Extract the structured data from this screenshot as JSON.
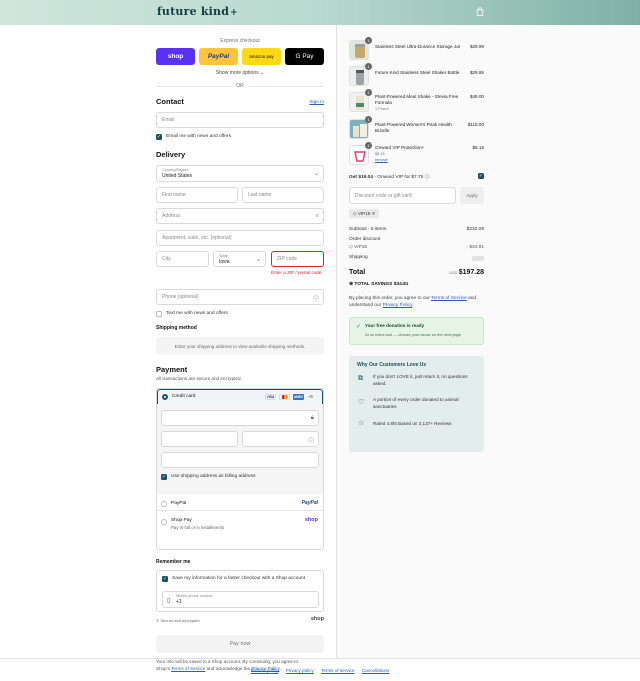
{
  "header": {
    "brand": "future kind",
    "brand_plus": "+"
  },
  "express": {
    "label": "Express checkout",
    "shop": "shop",
    "paypal": "PayPal",
    "amazon": "amazon pay",
    "gpay": "G Pay",
    "show_more": "Show more options",
    "or": "OR"
  },
  "contact": {
    "title": "Contact",
    "sign_in": "Sign in",
    "email_placeholder": "Email",
    "news_label": "Email me with news and offers"
  },
  "delivery": {
    "title": "Delivery",
    "country_label": "Country/Region",
    "country_value": "United States",
    "first_name": "First name",
    "last_name": "Last name",
    "address": "Address",
    "apartment": "Apartment, suite, etc. (optional)",
    "city": "City",
    "state_label": "State",
    "state_value": "Iowa",
    "zip": "ZIP code",
    "zip_error": "Enter a ZIP / postal code",
    "phone": "Phone (optional)",
    "text_news": "Text me with news and offers"
  },
  "shipping": {
    "title": "Shipping method",
    "info": "Enter your shipping address to view available shipping methods."
  },
  "payment": {
    "title": "Payment",
    "subtitle": "All transactions are secure and encrypted.",
    "credit_card": "Credit card",
    "card_logos": [
      "VISA",
      "MC",
      "AMEX"
    ],
    "more_cards": "+5",
    "billing_same": "Use shipping address as billing address",
    "paypal": "PayPal",
    "paypal_logo": "PayPal",
    "shop_pay": "Shop Pay",
    "shop_pay_sub": "Pay in full or in installments",
    "shop_pay_logo": "shop"
  },
  "remember": {
    "title": "Remember me",
    "save_label": "Save my information for a faster checkout with a Shop account",
    "mobile_label": "Mobile phone number",
    "mobile_value": "+1",
    "secure": "Secure and encrypted",
    "shop_logo": "shop"
  },
  "pay_now": "Pay now",
  "legal": {
    "line1": "Your info will be saved to a Shop account. By continuing, you agree to",
    "line2_prefix": "Shop's ",
    "terms": "Terms of Service",
    "line2_mid": " and acknowledge the ",
    "privacy": "Privacy Policy",
    "line2_end": "."
  },
  "footer": [
    "Refund policy",
    "Privacy policy",
    "Terms of service",
    "Cancellations"
  ],
  "cart": {
    "items": [
      {
        "qty": "1",
        "name": "Stainless Steel Ultra-Durance Storage Jar",
        "price": "$29.99",
        "sub": ""
      },
      {
        "qty": "1",
        "name": "Future Kind Stainless Steel Shaker Bottle",
        "price": "$29.95",
        "sub": ""
      },
      {
        "qty": "1",
        "name": "Plant-Powered Meal Shake - Stevia Free Formula",
        "price": "$49.00",
        "sub": "1 Pouch"
      },
      {
        "qty": "1",
        "name": "Plant-Powered Women's Peak Health Bundle",
        "price": "$115.00",
        "sub": ""
      },
      {
        "qty": "1",
        "name": "Onward VIP Protection+",
        "price": "$8.15",
        "sub": "$8.15",
        "remove": "remove"
      }
    ],
    "onward_bold": "Get $19.04",
    "onward_rest": " - Onward VIP for $7.75",
    "discount_placeholder": "Discount code or gift card",
    "apply": "Apply",
    "tag": "VIP15",
    "subtotal_label": "Subtotal · 5 items",
    "subtotal_value": "$232.09",
    "order_discount": "Order discount",
    "discount_code": "VIP15",
    "discount_value": "- $34.81",
    "shipping_label": "Shipping",
    "total_label": "Total",
    "currency": "USD",
    "total_value": "$197.28",
    "savings_label": "TOTAL SAVINGS",
    "savings_value": "$34.81",
    "agree_prefix": "By placing this order, you agree to our ",
    "agree_terms": "Terms of Service",
    "agree_mid": " and understand our ",
    "agree_privacy": "Privacy Policy",
    "agree_end": ".",
    "donation_title": "Your free donation is ready",
    "donation_sub": "At no extra cost — choose your cause on the next page.",
    "love_title": "Why Our Customers Love Us",
    "love_items": [
      "If you don't LOVE it, just return it, no questions asked.",
      "A portion of every order donated to animal sanctuaries",
      "Rated 4.8/5 Based on 2,137+ Reviews"
    ]
  },
  "colors": {
    "accent": "#1d4f61",
    "error": "#e02525",
    "shop": "#5a31f4",
    "paypal": "#ffc439"
  }
}
